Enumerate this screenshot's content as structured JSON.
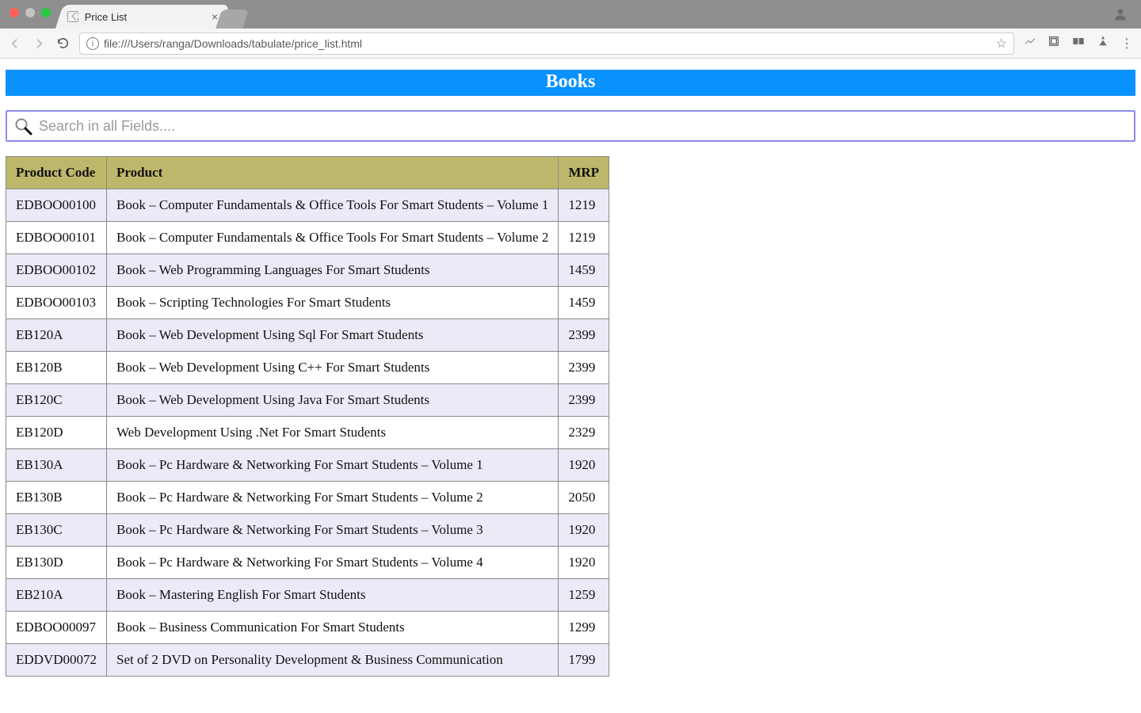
{
  "browser": {
    "tab_title": "Price List",
    "url": "file:///Users/ranga/Downloads/tabulate/price_list.html"
  },
  "page": {
    "banner_title": "Books",
    "search_placeholder": "Search in all Fields....",
    "columns": {
      "code": "Product Code",
      "product": "Product",
      "mrp": "MRP"
    },
    "rows": [
      {
        "code": "EDBOO00100",
        "product": "Book – Computer Fundamentals & Office Tools For Smart Students – Volume 1",
        "mrp": "1219"
      },
      {
        "code": "EDBOO00101",
        "product": "Book – Computer Fundamentals & Office Tools For Smart Students – Volume 2",
        "mrp": "1219"
      },
      {
        "code": "EDBOO00102",
        "product": "Book – Web Programming Languages For Smart Students",
        "mrp": "1459"
      },
      {
        "code": "EDBOO00103",
        "product": "Book – Scripting Technologies For Smart Students",
        "mrp": "1459"
      },
      {
        "code": "EB120A",
        "product": "Book – Web Development Using Sql For Smart Students",
        "mrp": "2399"
      },
      {
        "code": "EB120B",
        "product": "Book – Web Development Using C++ For Smart Students",
        "mrp": "2399"
      },
      {
        "code": "EB120C",
        "product": "Book – Web Development Using Java For Smart Students",
        "mrp": "2399"
      },
      {
        "code": "EB120D",
        "product": "Web Development Using .Net For Smart Students",
        "mrp": "2329"
      },
      {
        "code": "EB130A",
        "product": "Book – Pc Hardware & Networking For Smart Students – Volume 1",
        "mrp": "1920"
      },
      {
        "code": "EB130B",
        "product": "Book – Pc Hardware & Networking For Smart Students – Volume 2",
        "mrp": "2050"
      },
      {
        "code": "EB130C",
        "product": "Book – Pc Hardware & Networking For Smart Students – Volume 3",
        "mrp": "1920"
      },
      {
        "code": "EB130D",
        "product": "Book – Pc Hardware & Networking For Smart Students – Volume 4",
        "mrp": "1920"
      },
      {
        "code": "EB210A",
        "product": "Book – Mastering English For Smart Students",
        "mrp": "1259"
      },
      {
        "code": "EDBOO00097",
        "product": "Book – Business Communication For Smart Students",
        "mrp": "1299"
      },
      {
        "code": "EDDVD00072",
        "product": "Set of 2 DVD on Personality Development & Business Communication",
        "mrp": "1799"
      }
    ]
  }
}
